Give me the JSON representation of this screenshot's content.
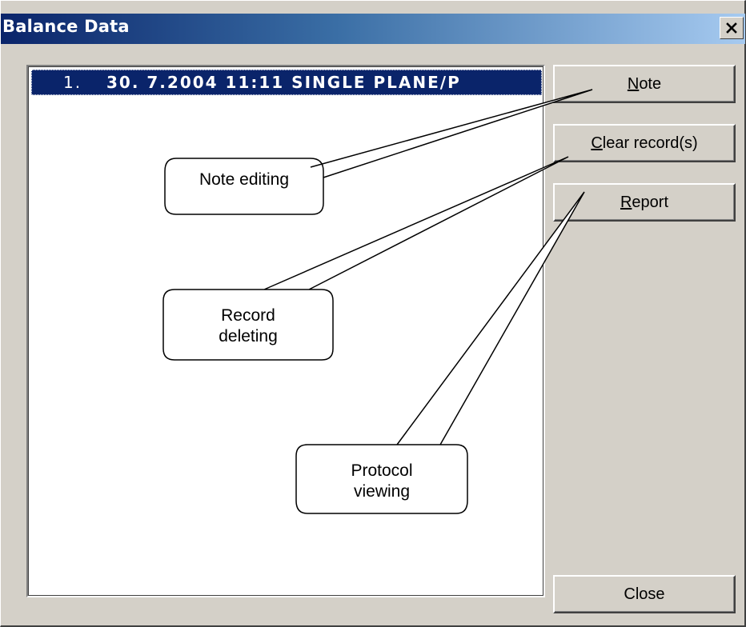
{
  "window": {
    "title": "Balance Data"
  },
  "list": {
    "rows": [
      {
        "number": "1.",
        "text": "30. 7.2004 11:11 SINGLE PLANE/P"
      }
    ]
  },
  "buttons": {
    "note": {
      "mnemonic": "N",
      "rest": "ote"
    },
    "clear": {
      "mnemonic": "C",
      "rest": "lear record(s)"
    },
    "report": {
      "mnemonic": "R",
      "rest": "eport"
    },
    "close": "Close"
  },
  "callouts": {
    "note": {
      "lines": [
        "Note editing"
      ]
    },
    "record": {
      "lines": [
        "Record",
        "deleting"
      ]
    },
    "protocol": {
      "lines": [
        "Protocol",
        "viewing"
      ]
    }
  },
  "icons": {
    "close": "close-icon"
  },
  "colors": {
    "title_start": "#0a246a",
    "title_end": "#a6caf0",
    "selection": "#0a246a",
    "face": "#d4d0c8"
  }
}
